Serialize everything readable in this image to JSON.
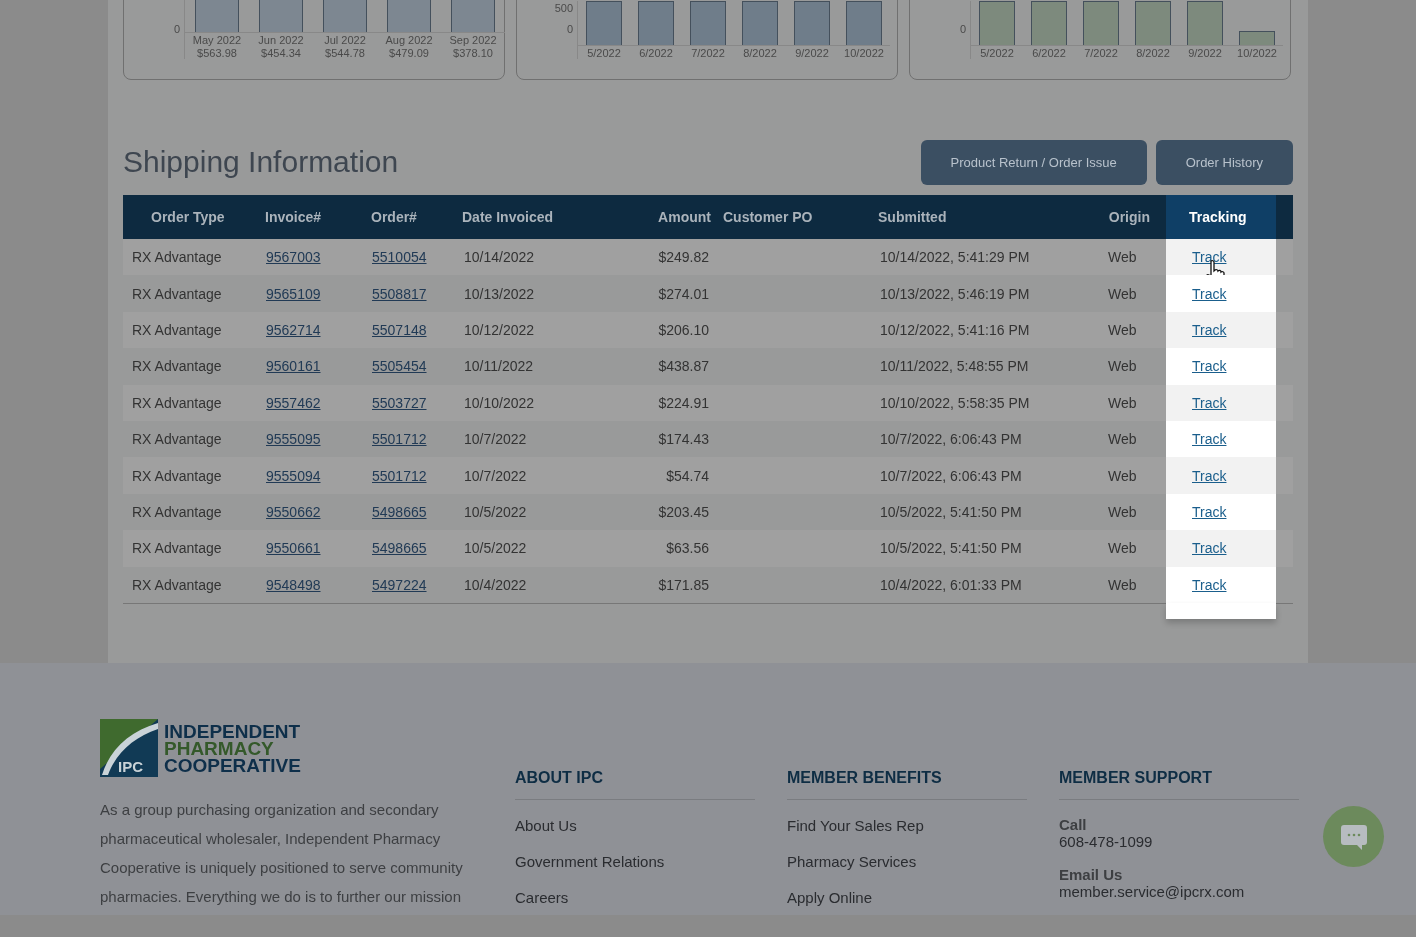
{
  "charts": [
    {
      "color": "#7d8791",
      "y_ticks": [
        "0"
      ],
      "categories": [
        {
          "label": "May 2022",
          "amount": "$563.98"
        },
        {
          "label": "Jun 2022",
          "amount": "$454.34"
        },
        {
          "label": "Jul 2022",
          "amount": "$544.78"
        },
        {
          "label": "Aug 2022",
          "amount": "$479.09"
        },
        {
          "label": "Sep 2022",
          "amount": "$378.10"
        }
      ]
    },
    {
      "color": "#6f7d8a",
      "y_ticks": [
        "500",
        "0"
      ],
      "categories": [
        {
          "label": "5/2022"
        },
        {
          "label": "6/2022"
        },
        {
          "label": "7/2022"
        },
        {
          "label": "8/2022"
        },
        {
          "label": "9/2022"
        },
        {
          "label": "10/2022"
        }
      ]
    },
    {
      "color": "#7d8a7d",
      "y_ticks": [
        "0"
      ],
      "categories": [
        {
          "label": "5/2022"
        },
        {
          "label": "6/2022"
        },
        {
          "label": "7/2022"
        },
        {
          "label": "8/2022"
        },
        {
          "label": "9/2022"
        },
        {
          "label": "10/2022"
        }
      ]
    }
  ],
  "section_title": "Shipping Information",
  "buttons": [
    "Product Return / Order Issue",
    "Order History"
  ],
  "table": {
    "columns": [
      {
        "label": "Order Type",
        "highlighted": false
      },
      {
        "label": "Invoice#",
        "highlighted": false
      },
      {
        "label": "Order#",
        "highlighted": false
      },
      {
        "label": "Date Invoiced",
        "highlighted": false
      },
      {
        "label": "Amount",
        "highlighted": false
      },
      {
        "label": "Customer PO",
        "highlighted": false
      },
      {
        "label": "Submitted",
        "highlighted": false
      },
      {
        "label": "Origin",
        "highlighted": false
      },
      {
        "label": "Tracking",
        "highlighted": true
      }
    ],
    "rows": [
      {
        "order_type": "RX Advantage",
        "invoice": "9567003",
        "order": "5510054",
        "date_invoiced": "10/14/2022",
        "amount": "$249.82",
        "submitted": "10/14/2022, 5:41:29 PM",
        "origin": "Web",
        "tracking": "Track"
      },
      {
        "order_type": "RX Advantage",
        "invoice": "9565109",
        "order": "5508817",
        "date_invoiced": "10/13/2022",
        "amount": "$274.01",
        "submitted": "10/13/2022, 5:46:19 PM",
        "origin": "Web",
        "tracking": "Track"
      },
      {
        "order_type": "RX Advantage",
        "invoice": "9562714",
        "order": "5507148",
        "date_invoiced": "10/12/2022",
        "amount": "$206.10",
        "submitted": "10/12/2022, 5:41:16 PM",
        "origin": "Web",
        "tracking": "Track"
      },
      {
        "order_type": "RX Advantage",
        "invoice": "9560161",
        "order": "5505454",
        "date_invoiced": "10/11/2022",
        "amount": "$438.87",
        "submitted": "10/11/2022, 5:48:55 PM",
        "origin": "Web",
        "tracking": "Track"
      },
      {
        "order_type": "RX Advantage",
        "invoice": "9557462",
        "order": "5503727",
        "date_invoiced": "10/10/2022",
        "amount": "$224.91",
        "submitted": "10/10/2022, 5:58:35 PM",
        "origin": "Web",
        "tracking": "Track"
      },
      {
        "order_type": "RX Advantage",
        "invoice": "9555095",
        "order": "5501712",
        "date_invoiced": "10/7/2022",
        "amount": "$174.43",
        "submitted": "10/7/2022, 6:06:43 PM",
        "origin": "Web",
        "tracking": "Track"
      },
      {
        "order_type": "RX Advantage",
        "invoice": "9555094",
        "order": "5501712",
        "date_invoiced": "10/7/2022",
        "amount": "$54.74",
        "submitted": "10/7/2022, 6:06:43 PM",
        "origin": "Web",
        "tracking": "Track"
      },
      {
        "order_type": "RX Advantage",
        "invoice": "9550662",
        "order": "5498665",
        "date_invoiced": "10/5/2022",
        "amount": "$203.45",
        "submitted": "10/5/2022, 5:41:50 PM",
        "origin": "Web",
        "tracking": "Track"
      },
      {
        "order_type": "RX Advantage",
        "invoice": "9550661",
        "order": "5498665",
        "date_invoiced": "10/5/2022",
        "amount": "$63.56",
        "submitted": "10/5/2022, 5:41:50 PM",
        "origin": "Web",
        "tracking": "Track"
      },
      {
        "order_type": "RX Advantage",
        "invoice": "9548498",
        "order": "5497224",
        "date_invoiced": "10/4/2022",
        "amount": "$171.85",
        "submitted": "10/4/2022, 6:01:33 PM",
        "origin": "Web",
        "tracking": "Track"
      }
    ]
  },
  "footer": {
    "logo": [
      "INDEPENDENT",
      "PHARMACY",
      "COOPERATIVE"
    ],
    "logo_mark": "IPC",
    "about": "As a group purchasing organization and secondary pharmaceutical wholesaler, Independent Pharmacy Cooperative is uniquely positioned to serve community pharmacies. Everything we do is to further our mission",
    "columns": [
      {
        "heading": "ABOUT IPC",
        "links": [
          "About Us",
          "Government Relations",
          "Careers"
        ]
      },
      {
        "heading": "MEMBER BENEFITS",
        "links": [
          "Find Your Sales Rep",
          "Pharmacy Services",
          "Apply Online"
        ]
      }
    ],
    "support": {
      "heading": "MEMBER SUPPORT",
      "contacts": [
        {
          "label": "Call",
          "value": "608-478-1099"
        },
        {
          "label": "Email Us",
          "value": "member.service@ipcrx.com"
        }
      ]
    }
  }
}
